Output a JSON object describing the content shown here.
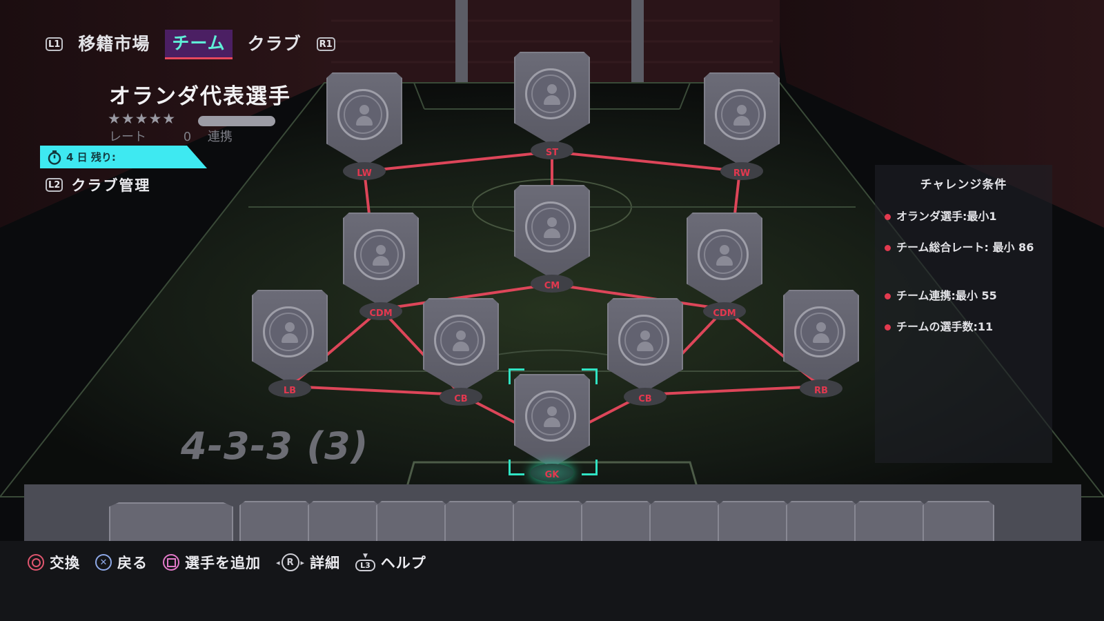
{
  "nav": {
    "left_key": "L1",
    "right_key": "R1",
    "tabs": [
      {
        "label": "移籍市場",
        "active": false
      },
      {
        "label": "チーム",
        "active": true
      },
      {
        "label": "クラブ",
        "active": false
      }
    ]
  },
  "squad": {
    "name": "オランダ代表選手",
    "stars": "★★★★★",
    "rating_label": "レート",
    "rating_value": "0",
    "chemistry_label": "連携",
    "timer_label": "4 日 残り:",
    "club_key": "L2",
    "club_label": "クラブ管理"
  },
  "requirements": {
    "title": "チャレンジ条件",
    "items": [
      "オランダ選手:最小1",
      "チーム総合レート: 最小 86",
      "チーム連携:最小 55",
      "チームの選手数:11"
    ]
  },
  "formation": {
    "name": "4-3-3 (3)",
    "positions": [
      "LW",
      "ST",
      "RW",
      "CM",
      "CDM",
      "CDM",
      "LB",
      "CB",
      "CB",
      "RB",
      "GK"
    ],
    "selected": "GK"
  },
  "bench": {
    "slot_count": 12
  },
  "footer": {
    "controls": [
      {
        "icon": "circle-button-icon",
        "label": "交換"
      },
      {
        "icon": "cross-button-icon",
        "label": "戻る"
      },
      {
        "icon": "square-button-icon",
        "label": "選手を追加"
      },
      {
        "icon": "right-stick-icon",
        "glyph": "R",
        "label": "詳細"
      },
      {
        "icon": "l3-stick-icon",
        "glyph": "L3",
        "label": "ヘルプ"
      }
    ]
  },
  "colors": {
    "accent_teal": "#5ff0d8",
    "timer_cyan": "#3ee9f1",
    "link_red": "#e8485d",
    "position_red": "#e3384f",
    "pitch_green": "#1f2a1f"
  }
}
